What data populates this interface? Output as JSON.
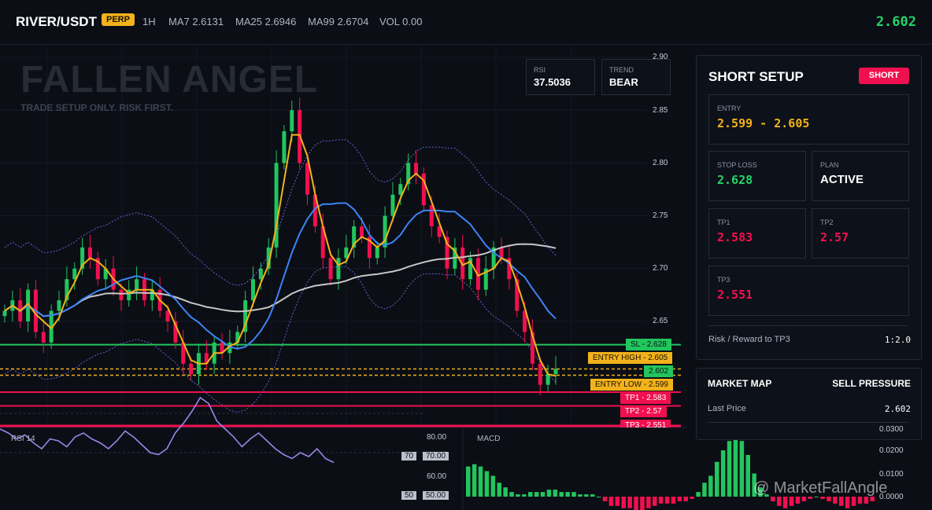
{
  "header": {
    "symbol": "RIVER/USDT",
    "badge": "PERP",
    "timeframe": "1H",
    "ma7": "MA7 2.6131",
    "ma25": "MA25 2.6946",
    "ma99": "MA99 2.6704",
    "volume": "VOL 0.00",
    "last_price": "2.602"
  },
  "watermark": {
    "title": "FALLEN ANGEL",
    "subtitle": "TRADE SETUP ONLY. RISK FIRST."
  },
  "indicators": {
    "rsi_label": "RSI",
    "rsi_value": "37.5036",
    "trend_label": "TREND",
    "trend_value": "BEAR"
  },
  "price_axis": [
    "2.90",
    "2.85",
    "2.80",
    "2.75",
    "2.70",
    "2.65"
  ],
  "levels": {
    "sl": "SL - 2.628",
    "entry_high": "ENTRY HIGH - 2.605",
    "last": "2.602",
    "entry_low": "ENTRY LOW - 2.599",
    "tp1": "TP1 - 2.583",
    "tp2": "TP2 - 2.57",
    "tp3": "TP3 - 2.551"
  },
  "setup": {
    "title": "SHORT SETUP",
    "badge": "SHORT",
    "entry_label": "ENTRY",
    "entry_value": "2.599 - 2.605",
    "stop_label": "STOP LOSS",
    "stop_value": "2.628",
    "plan_label": "PLAN",
    "plan_value": "ACTIVE",
    "tp1_label": "TP1",
    "tp1_value": "2.583",
    "tp2_label": "TP2",
    "tp2_value": "2.57",
    "tp3_label": "TP3",
    "tp3_value": "2.551",
    "rr_label": "Risk / Reward to TP3",
    "rr_value": "1:2.0"
  },
  "market_map": {
    "title": "MARKET MAP",
    "pressure": "SELL PRESSURE",
    "last_label": "Last Price",
    "last_value": "2.602"
  },
  "rsi_panel": {
    "title": "RSI 14",
    "axis": [
      "80.00",
      "70.00",
      "60.00",
      "50.00"
    ],
    "tag70": "70",
    "tag50": "50"
  },
  "macd_panel": {
    "title": "MACD",
    "axis": [
      "0.0300",
      "0.0200",
      "0.0100",
      "0.0000"
    ]
  },
  "credit": "@ MarketFallAngle",
  "colors": {
    "bull": "#22c55e",
    "bear": "#f0104f",
    "ma7": "#f2b21b",
    "ma25": "#3d84f5",
    "ma99": "#c7c7c7",
    "bb": "#6b5fd0",
    "rsi": "#9d84e8"
  }
}
